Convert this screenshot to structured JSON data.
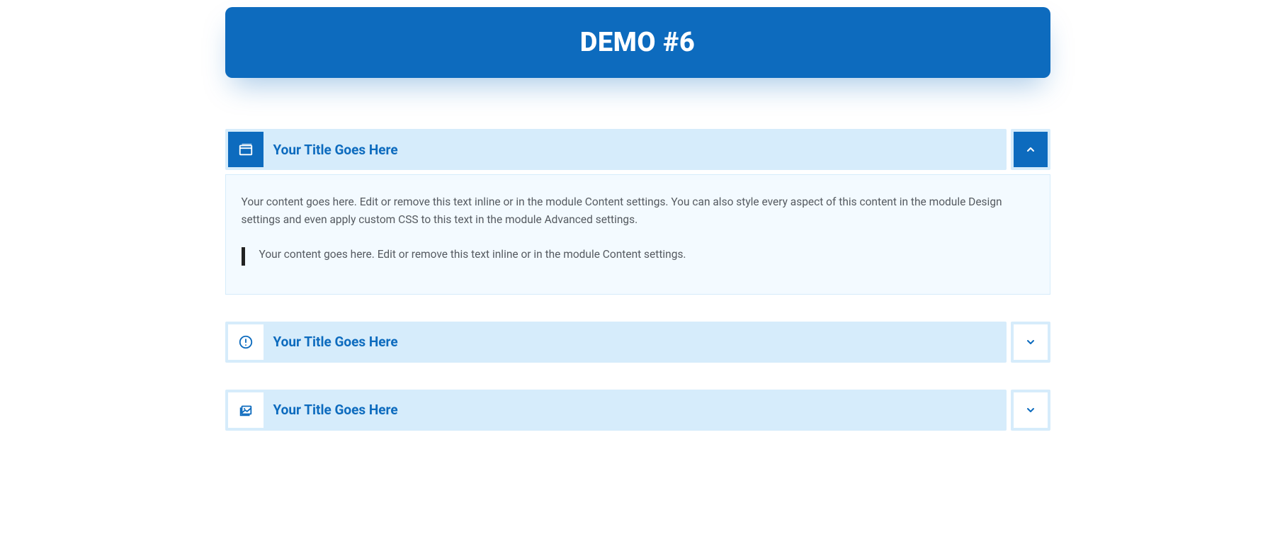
{
  "header": {
    "title": "DEMO #6"
  },
  "accordion": [
    {
      "title": "Your Title Goes Here",
      "icon": "window-icon",
      "expanded": true,
      "content": "Your content goes here. Edit or remove this text inline or in the module Content settings. You can also style every aspect of this content in the module Design settings and even apply custom CSS to this text in the module Advanced settings.",
      "quote": "Your content goes here. Edit or remove this text inline or in the module Content settings."
    },
    {
      "title": "Your Title Goes Here",
      "icon": "alert-circle-icon",
      "expanded": false
    },
    {
      "title": "Your Title Goes Here",
      "icon": "images-icon",
      "expanded": false
    }
  ]
}
